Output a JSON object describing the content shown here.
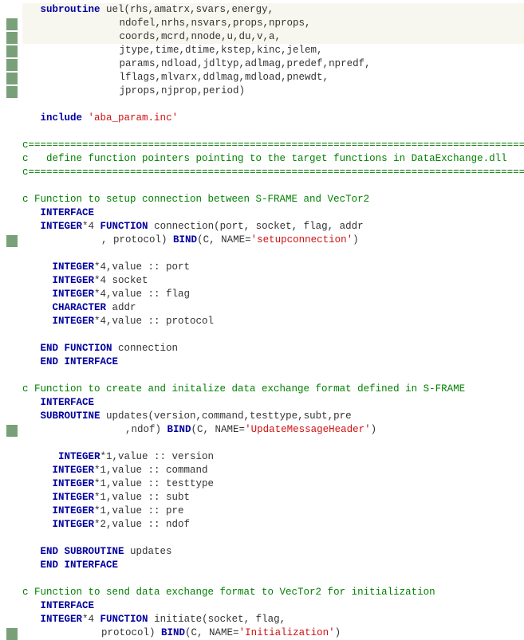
{
  "lines": [
    {
      "cls": "hl",
      "frags": [
        {
          "t": "   ",
          "c": "plain"
        },
        {
          "t": "subroutine",
          "c": "kw"
        },
        {
          "t": " uel(rhs,amatrx,svars,energy,",
          "c": "plain"
        }
      ]
    },
    {
      "cls": "hl",
      "cont": true,
      "frags": [
        {
          "t": "                 ndofel,nrhs,nsvars,props,nprops,",
          "c": "plain"
        }
      ]
    },
    {
      "cls": "hl",
      "cont": true,
      "frags": [
        {
          "t": "                 coords,mcrd,nnode,u,du,v,a,",
          "c": "plain"
        }
      ]
    },
    {
      "cls": "",
      "cont": true,
      "frags": [
        {
          "t": "                 jtype,time,dtime,kstep,kinc,jelem,",
          "c": "plain"
        }
      ]
    },
    {
      "cls": "",
      "cont": true,
      "frags": [
        {
          "t": "                 params,ndload,jdltyp,adlmag,predef,npredf,",
          "c": "plain"
        }
      ]
    },
    {
      "cls": "",
      "cont": true,
      "frags": [
        {
          "t": "                 lflags,mlvarx,ddlmag,mdload,pnewdt,",
          "c": "plain"
        }
      ]
    },
    {
      "cls": "",
      "cont": true,
      "frags": [
        {
          "t": "                 jprops,njprop,period)",
          "c": "plain"
        }
      ]
    },
    {
      "cls": "",
      "frags": [
        {
          "t": "",
          "c": "plain"
        }
      ]
    },
    {
      "cls": "",
      "frags": [
        {
          "t": "   ",
          "c": "plain"
        },
        {
          "t": "include",
          "c": "kw"
        },
        {
          "t": " ",
          "c": "plain"
        },
        {
          "t": "'aba_param.inc'",
          "c": "str"
        }
      ]
    },
    {
      "cls": "",
      "frags": [
        {
          "t": "",
          "c": "plain"
        }
      ]
    },
    {
      "cls": "",
      "frags": [
        {
          "t": "c=================================================================================================",
          "c": "cmt"
        }
      ]
    },
    {
      "cls": "",
      "frags": [
        {
          "t": "c   define function pointers pointing to the target functions in DataExchange.dll",
          "c": "cmt"
        }
      ]
    },
    {
      "cls": "",
      "frags": [
        {
          "t": "c=================================================================================================",
          "c": "cmt"
        }
      ]
    },
    {
      "cls": "",
      "frags": [
        {
          "t": "",
          "c": "plain"
        }
      ]
    },
    {
      "cls": "",
      "frags": [
        {
          "t": "c Function to setup connection between S-FRAME and VecTor2",
          "c": "cmt"
        }
      ]
    },
    {
      "cls": "",
      "frags": [
        {
          "t": "   ",
          "c": "plain"
        },
        {
          "t": "INTERFACE",
          "c": "kw"
        }
      ]
    },
    {
      "cls": "",
      "frags": [
        {
          "t": "   ",
          "c": "plain"
        },
        {
          "t": "INTEGER",
          "c": "kw"
        },
        {
          "t": "*4 ",
          "c": "plain"
        },
        {
          "t": "FUNCTION",
          "c": "kw"
        },
        {
          "t": " connection(port, socket, flag, addr",
          "c": "plain"
        }
      ]
    },
    {
      "cls": "",
      "cont": true,
      "frags": [
        {
          "t": "              , protocol) ",
          "c": "plain"
        },
        {
          "t": "BIND",
          "c": "kw"
        },
        {
          "t": "(C, NAME=",
          "c": "plain"
        },
        {
          "t": "'setupconnection'",
          "c": "str"
        },
        {
          "t": ")",
          "c": "plain"
        }
      ]
    },
    {
      "cls": "",
      "frags": [
        {
          "t": "",
          "c": "plain"
        }
      ]
    },
    {
      "cls": "",
      "frags": [
        {
          "t": "     ",
          "c": "plain"
        },
        {
          "t": "INTEGER",
          "c": "kw"
        },
        {
          "t": "*4,value :: port",
          "c": "plain"
        }
      ]
    },
    {
      "cls": "",
      "frags": [
        {
          "t": "     ",
          "c": "plain"
        },
        {
          "t": "INTEGER",
          "c": "kw"
        },
        {
          "t": "*4 socket",
          "c": "plain"
        }
      ]
    },
    {
      "cls": "",
      "frags": [
        {
          "t": "     ",
          "c": "plain"
        },
        {
          "t": "INTEGER",
          "c": "kw"
        },
        {
          "t": "*4,value :: flag",
          "c": "plain"
        }
      ]
    },
    {
      "cls": "",
      "frags": [
        {
          "t": "     ",
          "c": "plain"
        },
        {
          "t": "CHARACTER",
          "c": "kw"
        },
        {
          "t": " addr",
          "c": "plain"
        }
      ]
    },
    {
      "cls": "",
      "frags": [
        {
          "t": "     ",
          "c": "plain"
        },
        {
          "t": "INTEGER",
          "c": "kw"
        },
        {
          "t": "*4,value :: protocol",
          "c": "plain"
        }
      ]
    },
    {
      "cls": "",
      "frags": [
        {
          "t": "",
          "c": "plain"
        }
      ]
    },
    {
      "cls": "",
      "frags": [
        {
          "t": "   ",
          "c": "plain"
        },
        {
          "t": "END FUNCTION",
          "c": "kw"
        },
        {
          "t": " connection",
          "c": "plain"
        }
      ]
    },
    {
      "cls": "",
      "frags": [
        {
          "t": "   ",
          "c": "plain"
        },
        {
          "t": "END INTERFACE",
          "c": "kw"
        }
      ]
    },
    {
      "cls": "",
      "frags": [
        {
          "t": "",
          "c": "plain"
        }
      ]
    },
    {
      "cls": "",
      "frags": [
        {
          "t": "c Function to create and initalize data exchange format defined in S-FRAME",
          "c": "cmt"
        }
      ]
    },
    {
      "cls": "",
      "frags": [
        {
          "t": "   ",
          "c": "plain"
        },
        {
          "t": "INTERFACE",
          "c": "kw"
        }
      ]
    },
    {
      "cls": "",
      "frags": [
        {
          "t": "   ",
          "c": "plain"
        },
        {
          "t": "SUBROUTINE",
          "c": "kw"
        },
        {
          "t": " updates(version,command,testtype,subt,pre",
          "c": "plain"
        }
      ]
    },
    {
      "cls": "",
      "cont": true,
      "frags": [
        {
          "t": "                  ,ndof) ",
          "c": "plain"
        },
        {
          "t": "BIND",
          "c": "kw"
        },
        {
          "t": "(C, NAME=",
          "c": "plain"
        },
        {
          "t": "'UpdateMessageHeader'",
          "c": "str"
        },
        {
          "t": ")",
          "c": "plain"
        }
      ]
    },
    {
      "cls": "",
      "frags": [
        {
          "t": "",
          "c": "plain"
        }
      ]
    },
    {
      "cls": "",
      "frags": [
        {
          "t": "      ",
          "c": "plain"
        },
        {
          "t": "INTEGER",
          "c": "kw"
        },
        {
          "t": "*1,value :: version",
          "c": "plain"
        }
      ]
    },
    {
      "cls": "",
      "frags": [
        {
          "t": "     ",
          "c": "plain"
        },
        {
          "t": "INTEGER",
          "c": "kw"
        },
        {
          "t": "*1,value :: command",
          "c": "plain"
        }
      ]
    },
    {
      "cls": "",
      "frags": [
        {
          "t": "     ",
          "c": "plain"
        },
        {
          "t": "INTEGER",
          "c": "kw"
        },
        {
          "t": "*1,value :: testtype",
          "c": "plain"
        }
      ]
    },
    {
      "cls": "",
      "frags": [
        {
          "t": "     ",
          "c": "plain"
        },
        {
          "t": "INTEGER",
          "c": "kw"
        },
        {
          "t": "*1,value :: subt",
          "c": "plain"
        }
      ]
    },
    {
      "cls": "",
      "frags": [
        {
          "t": "     ",
          "c": "plain"
        },
        {
          "t": "INTEGER",
          "c": "kw"
        },
        {
          "t": "*1,value :: pre",
          "c": "plain"
        }
      ]
    },
    {
      "cls": "",
      "frags": [
        {
          "t": "     ",
          "c": "plain"
        },
        {
          "t": "INTEGER",
          "c": "kw"
        },
        {
          "t": "*2,value :: ndof",
          "c": "plain"
        }
      ]
    },
    {
      "cls": "",
      "frags": [
        {
          "t": "",
          "c": "plain"
        }
      ]
    },
    {
      "cls": "",
      "frags": [
        {
          "t": "   ",
          "c": "plain"
        },
        {
          "t": "END SUBROUTINE",
          "c": "kw"
        },
        {
          "t": " updates",
          "c": "plain"
        }
      ]
    },
    {
      "cls": "",
      "frags": [
        {
          "t": "   ",
          "c": "plain"
        },
        {
          "t": "END INTERFACE",
          "c": "kw"
        }
      ]
    },
    {
      "cls": "",
      "frags": [
        {
          "t": "",
          "c": "plain"
        }
      ]
    },
    {
      "cls": "",
      "frags": [
        {
          "t": "c Function to send data exchange format to VecTor2 for initialization",
          "c": "cmt"
        }
      ]
    },
    {
      "cls": "",
      "frags": [
        {
          "t": "   ",
          "c": "plain"
        },
        {
          "t": "INTERFACE",
          "c": "kw"
        }
      ]
    },
    {
      "cls": "",
      "frags": [
        {
          "t": "   ",
          "c": "plain"
        },
        {
          "t": "INTEGER",
          "c": "kw"
        },
        {
          "t": "*4 ",
          "c": "plain"
        },
        {
          "t": "FUNCTION",
          "c": "kw"
        },
        {
          "t": " initiate(socket, flag,",
          "c": "plain"
        }
      ]
    },
    {
      "cls": "",
      "cont": true,
      "frags": [
        {
          "t": "              protocol) ",
          "c": "plain"
        },
        {
          "t": "BIND",
          "c": "kw"
        },
        {
          "t": "(C, NAME=",
          "c": "plain"
        },
        {
          "t": "'Initialization'",
          "c": "str"
        },
        {
          "t": ")",
          "c": "plain"
        }
      ]
    }
  ]
}
